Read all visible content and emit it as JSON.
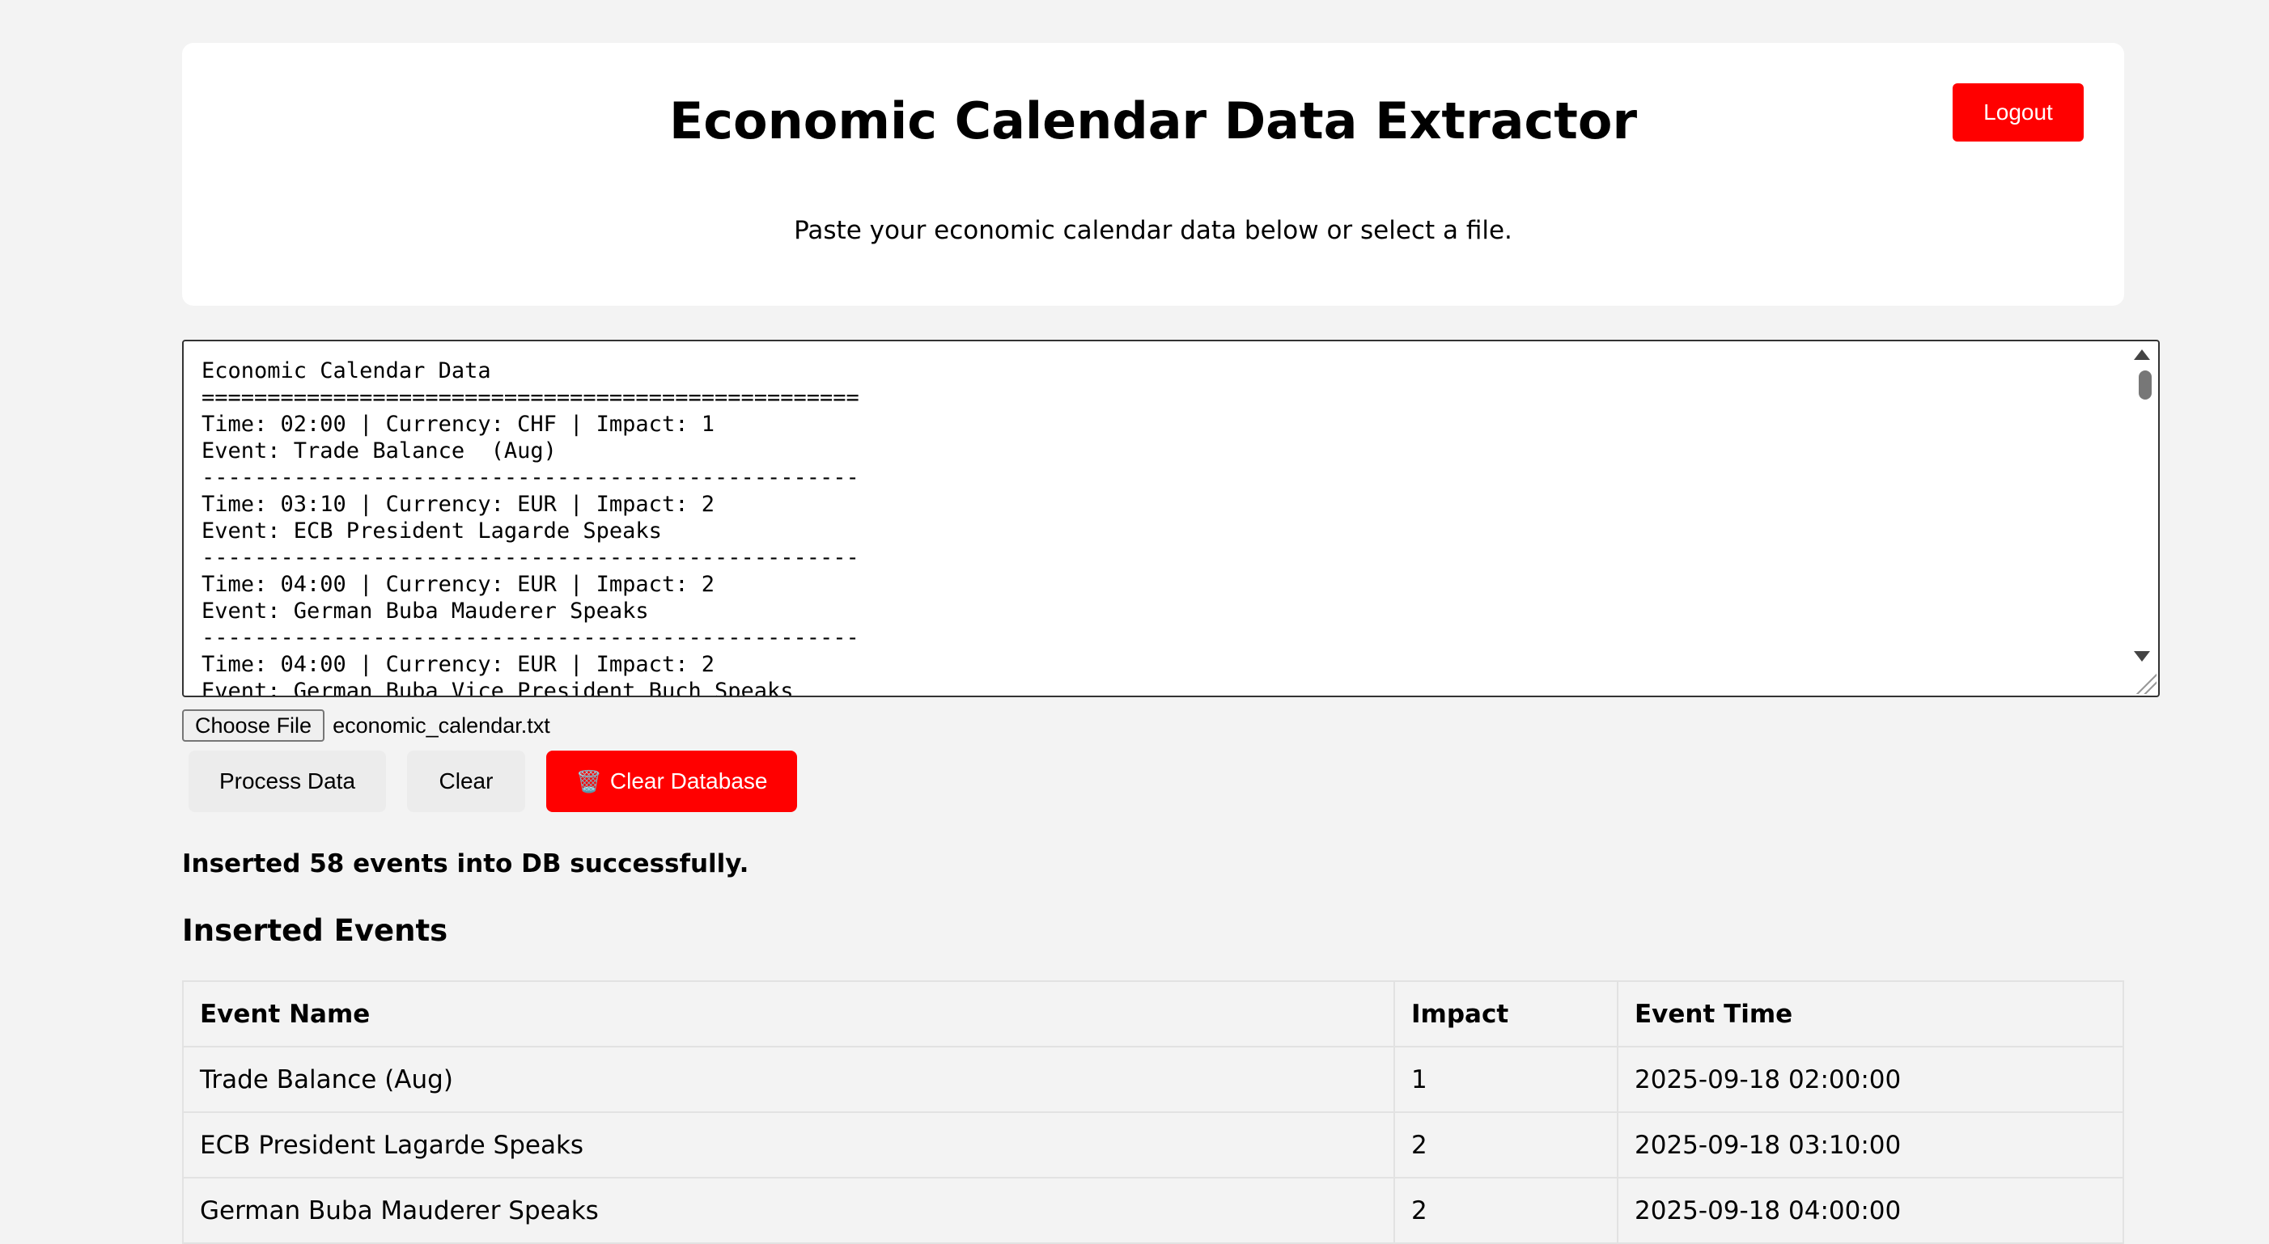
{
  "header": {
    "title": "Economic Calendar Data Extractor",
    "subtitle": "Paste your economic calendar data below or select a file.",
    "logout_label": "Logout"
  },
  "editor": {
    "content": "Economic Calendar Data\n==================================================\nTime: 02:00 | Currency: CHF | Impact: 1\nEvent: Trade Balance  (Aug)\n--------------------------------------------------\nTime: 03:10 | Currency: EUR | Impact: 2\nEvent: ECB President Lagarde Speaks\n--------------------------------------------------\nTime: 04:00 | Currency: EUR | Impact: 2\nEvent: German Buba Mauderer Speaks\n--------------------------------------------------\nTime: 04:00 | Currency: EUR | Impact: 2\nEvent: German Buba Vice President Buch Speaks"
  },
  "file_input": {
    "button_label": "Choose File",
    "file_name": "economic_calendar.txt"
  },
  "actions": {
    "process_label": "Process Data",
    "clear_label": "Clear",
    "clear_db_icon": "🗑️",
    "clear_db_label": "Clear Database"
  },
  "status_message": "Inserted 58 events into DB successfully.",
  "results": {
    "title": "Inserted Events",
    "columns": [
      "Event Name",
      "Impact",
      "Event Time"
    ],
    "rows": [
      [
        "Trade Balance (Aug)",
        "1",
        "2025-09-18 02:00:00"
      ],
      [
        "ECB President Lagarde Speaks",
        "2",
        "2025-09-18 03:10:00"
      ],
      [
        "German Buba Mauderer Speaks",
        "2",
        "2025-09-18 04:00:00"
      ]
    ]
  },
  "colors": {
    "danger": "#ff0000",
    "background": "#f3f3f3",
    "card": "#ffffff"
  }
}
